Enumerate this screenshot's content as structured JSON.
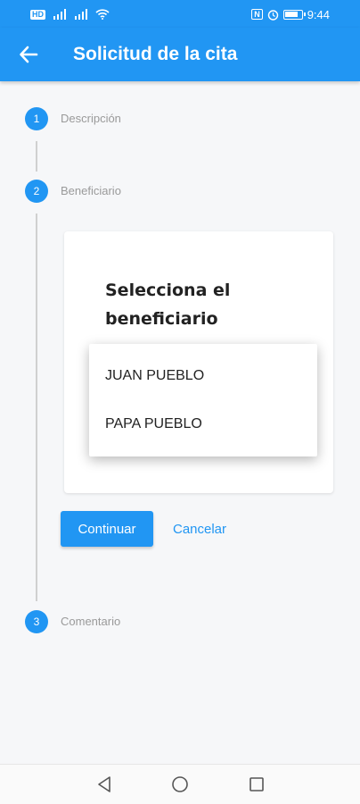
{
  "status_bar": {
    "network_badge": "HD",
    "time": "9:44",
    "nfc": "N",
    "icons": [
      "network-badge-icon",
      "signal-icon",
      "signal-icon",
      "wifi-icon",
      "nfc-icon",
      "alarm-icon",
      "battery-icon"
    ]
  },
  "app_bar": {
    "title": "Solicitud de la cita",
    "back_icon": "arrow-left-icon"
  },
  "stepper": {
    "steps": [
      {
        "number": "1",
        "label": "Descripción"
      },
      {
        "number": "2",
        "label": "Beneficiario"
      },
      {
        "number": "3",
        "label": "Comentario"
      }
    ],
    "active_step": 2
  },
  "card": {
    "title": "Selecciona el beneficiario",
    "options": [
      "JUAN PUEBLO",
      "PAPA PUEBLO"
    ]
  },
  "actions": {
    "continue_label": "Continuar",
    "cancel_label": "Cancelar"
  },
  "nav_bar": {
    "icons": [
      "back-triangle-icon",
      "home-circle-icon",
      "recents-square-icon"
    ]
  },
  "colors": {
    "primary": "#2196f3",
    "background": "#f6f7f9",
    "step_label": "#9a9a9a"
  }
}
